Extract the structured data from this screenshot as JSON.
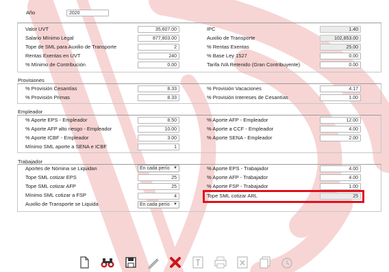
{
  "year": {
    "label": "Año",
    "value": "2020"
  },
  "general": {
    "left": [
      {
        "label": "Valor UVT",
        "value": "35,607.00"
      },
      {
        "label": "Salario Mínimo Legal",
        "value": "877,803.00"
      },
      {
        "label": "Tope de SML para Auxilio de Transporte",
        "value": "2"
      },
      {
        "label": "Rentas Exentas en UVT",
        "value": "240"
      },
      {
        "label": "% Mínimo de Contribución",
        "value": "0.00"
      }
    ],
    "right": [
      {
        "label": "IPC",
        "value": "1.40"
      },
      {
        "label": "Auxilio de Transporte",
        "value": "102,853.00"
      },
      {
        "label": "% Rentas Exentas",
        "value": "25.00"
      },
      {
        "label": "% Base Ley 1527",
        "value": "0.00"
      },
      {
        "label": "Tarifa IVA Retenido (Gran Contribuyente)",
        "value": "0.00"
      }
    ]
  },
  "provisiones": {
    "title": "Provisiones",
    "left": [
      {
        "label": "% Provisión Cesantías",
        "value": "8.33"
      },
      {
        "label": "% Provisión Primas",
        "value": "8.33"
      }
    ],
    "right": [
      {
        "label": "% Provisión Vacaciones",
        "value": "4.17"
      },
      {
        "label": "% Provisión Intereses de Cesantías",
        "value": "1.00"
      }
    ]
  },
  "empleador": {
    "title": "Empleador",
    "left": [
      {
        "label": "% Aporte EPS - Empleador",
        "value": "8.50"
      },
      {
        "label": "% Aporte AFP alto riesgo - Empleador",
        "value": "10.00"
      },
      {
        "label": "% Aporte ICBF - Empleador",
        "value": "3.00"
      },
      {
        "label": "Mínimo SML aporte a SENA e ICBF",
        "value": "1"
      }
    ],
    "right": [
      {
        "label": "% Aporte AFP - Empleador",
        "value": "12.00"
      },
      {
        "label": "% Aporte a CCF - Empleador",
        "value": "4.00"
      },
      {
        "label": "% Aporte SENA - Empleador",
        "value": "2.00"
      }
    ]
  },
  "trabajador": {
    "title": "Trabajador",
    "left": [
      {
        "label": "Aportes de Nómina se Liquidan",
        "value": "En cada perío"
      },
      {
        "label": "Tope SML cotizar EPS",
        "value": "25"
      },
      {
        "label": "Tope SML cotizar AFP",
        "value": "25"
      },
      {
        "label": "Mínimo SML cotizar a FSP",
        "value": "4"
      },
      {
        "label": "Auxilio de Transporte se Liquida",
        "value": "En cada perío"
      }
    ],
    "right": [
      {
        "label": "% Aporte EPS - Trabajador",
        "value": "4.00"
      },
      {
        "label": "% Aporte AFP - Trabajador",
        "value": "4.00"
      },
      {
        "label": "% Aporte FSP - Trabajador",
        "value": "1.00"
      },
      {
        "label": "Tope SML cotizar ARL",
        "value": "25"
      }
    ]
  },
  "toolbar": {
    "buttons": [
      "new-document-icon",
      "binoculars-icon",
      "save-disk-icon",
      "pencil-icon",
      "delete-x-icon",
      "text-icon",
      "print-icon",
      "excel-icon",
      "documents-icon",
      "history-icon"
    ]
  },
  "colors": {
    "accent": "#e0101c",
    "watermark": "#f7d2d2",
    "readonly_bg": "#ebebeb"
  }
}
